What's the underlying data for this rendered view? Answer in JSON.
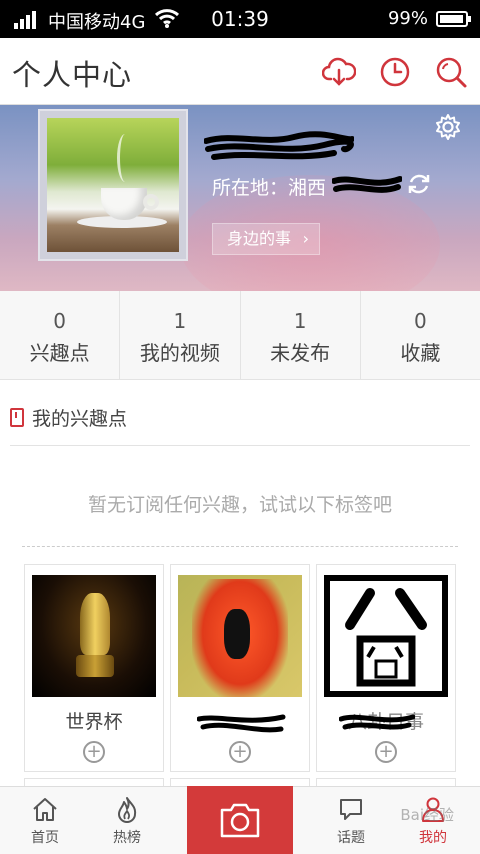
{
  "status_bar": {
    "carrier": "中国移动4G",
    "time": "01:39",
    "battery": "99%"
  },
  "header": {
    "title": "个人中心",
    "icons": [
      "cloud-download-icon",
      "clock-icon",
      "search-icon"
    ],
    "accent": "#d0353c"
  },
  "profile": {
    "location_label": "所在地：湘西",
    "nearby_label": "身边的事",
    "nearby_chevron": "›"
  },
  "stats": [
    {
      "value": "0",
      "label": "兴趣点"
    },
    {
      "value": "1",
      "label": "我的视频"
    },
    {
      "value": "1",
      "label": "未发布"
    },
    {
      "value": "0",
      "label": "收藏"
    }
  ],
  "interests": {
    "section_title": "我的兴趣点",
    "empty_hint": "暂无订阅任何兴趣，试试以下标签吧",
    "tags": [
      {
        "name": "世界杯",
        "add": "+"
      },
      {
        "name": "",
        "add": "+"
      },
      {
        "name": "八卦日事",
        "add": "+"
      }
    ]
  },
  "tabbar": {
    "tabs": [
      {
        "label": "首页",
        "icon": "home-icon"
      },
      {
        "label": "热榜",
        "icon": "flame-icon"
      },
      {
        "label": "话题",
        "icon": "chat-bubble-icon"
      },
      {
        "label": "我的",
        "icon": "person-icon"
      }
    ],
    "camera_icon": "camera-icon",
    "active_color": "#d0353c",
    "camera_color": "#d33a3a"
  },
  "watermark": "Bai经验"
}
